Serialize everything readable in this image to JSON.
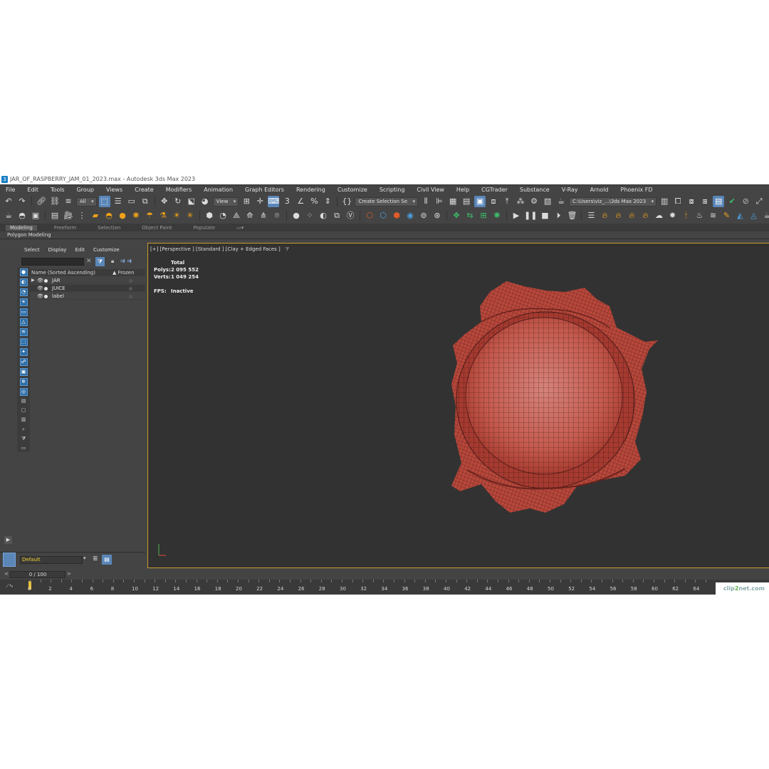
{
  "window": {
    "title": "JAR_OF_RASPBERRY_JAM_01_2023.max - Autodesk 3ds Max 2023"
  },
  "menu": [
    "File",
    "Edit",
    "Tools",
    "Group",
    "Views",
    "Create",
    "Modifiers",
    "Animation",
    "Graph Editors",
    "Rendering",
    "Customize",
    "Scripting",
    "Civil View",
    "Help",
    "CGTrader",
    "Substance",
    "V-Ray",
    "Arnold",
    "Phoenix FD"
  ],
  "toolbar": {
    "selection_filter": "All",
    "ref_coord": "View",
    "named_selection": "Create Selection Se",
    "project_path": "C:\\Users\\viz_...\\3ds Max 2023"
  },
  "ribbon": {
    "tabs": [
      "Modeling",
      "Freeform",
      "Selection",
      "Object Paint",
      "Populate"
    ],
    "active_tab": "Modeling",
    "sub_label": "Polygon Modeling"
  },
  "explorer": {
    "menu": [
      "Select",
      "Display",
      "Edit",
      "Customize"
    ],
    "col_name": "Name (Sorted Ascending)",
    "col_frozen": "▲ Frozen",
    "rows": [
      {
        "name": "JAR",
        "expandable": true
      },
      {
        "name": "JUICE",
        "expandable": false
      },
      {
        "name": "label",
        "expandable": false
      }
    ],
    "layer": "Default"
  },
  "viewport": {
    "label": "[+] [Perspective ] [Standard ] [Clay + Edged Faces ]",
    "stats_header": "Total",
    "polys_label": "Polys:",
    "polys": "2 095 552",
    "verts_label": "Verts:",
    "verts": "1 049 254",
    "fps_label": "FPS:",
    "fps": "Inactive"
  },
  "timeline": {
    "frame": "0 / 100",
    "prev": "<",
    "next": ">",
    "ticks": [
      0,
      2,
      4,
      6,
      8,
      10,
      12,
      14,
      16,
      18,
      20,
      22,
      24,
      26,
      28,
      30,
      32,
      34,
      36,
      38,
      40,
      42,
      44,
      46,
      48,
      50,
      52,
      54,
      56,
      58,
      60,
      62,
      64
    ]
  },
  "watermark": {
    "pre": "clip",
    "mid": "2",
    "post": "net.com"
  },
  "colors": {
    "model": "#c2483b",
    "viewport_border": "#c89b2e",
    "accent": "#5a86b8"
  }
}
